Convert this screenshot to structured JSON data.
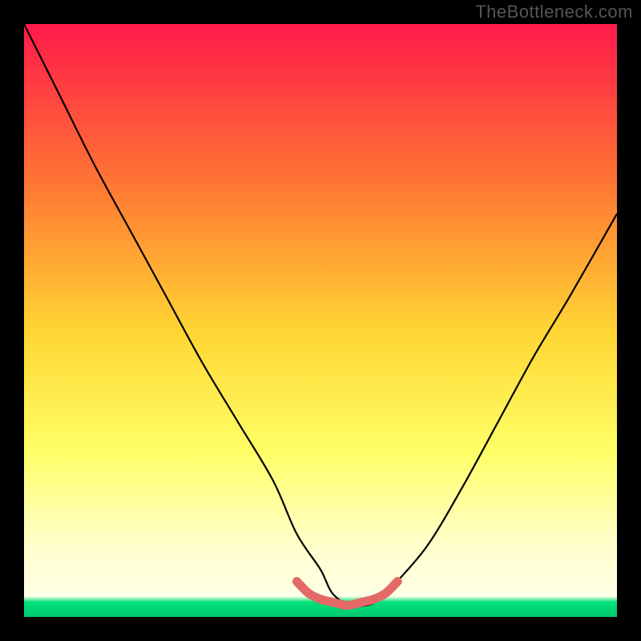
{
  "watermark": "TheBottleneck.com",
  "colors": {
    "background": "#000000",
    "watermark": "#555555",
    "curve": "#000000",
    "overlay": "#e36a67",
    "gradient_top": "#ff1a4a",
    "gradient_mid_upper": "#ff7a33",
    "gradient_mid": "#ffd633",
    "gradient_mid_lower": "#ffff66",
    "gradient_pale": "#ffffcc",
    "gradient_bottom": "#00e07a"
  },
  "chart_data": {
    "type": "line",
    "title": "",
    "xlabel": "",
    "ylabel": "",
    "xlim": [
      0,
      100
    ],
    "ylim": [
      0,
      100
    ],
    "series": [
      {
        "name": "main-curve",
        "x": [
          0,
          6,
          12,
          18,
          24,
          30,
          36,
          42,
          46,
          50,
          52,
          55,
          58,
          60,
          62,
          68,
          74,
          80,
          86,
          92,
          100
        ],
        "y": [
          100,
          88,
          76,
          65,
          54,
          43,
          33,
          23,
          14,
          8,
          4,
          2,
          2,
          3,
          5,
          12,
          22,
          33,
          44,
          54,
          68
        ]
      },
      {
        "name": "bottom-overlay",
        "x": [
          46,
          48,
          50,
          52,
          54,
          55,
          57,
          59,
          61,
          63
        ],
        "y": [
          6,
          4,
          3,
          2.5,
          2,
          2,
          2.5,
          3,
          4,
          6
        ]
      }
    ],
    "gradient_stops": [
      {
        "offset": 0.0,
        "color": "#ff1a4a"
      },
      {
        "offset": 0.28,
        "color": "#ff7a33"
      },
      {
        "offset": 0.52,
        "color": "#ffd633"
      },
      {
        "offset": 0.72,
        "color": "#ffff66"
      },
      {
        "offset": 0.88,
        "color": "#ffffcc"
      },
      {
        "offset": 0.965,
        "color": "#ffffe6"
      },
      {
        "offset": 0.975,
        "color": "#00e07a"
      },
      {
        "offset": 1.0,
        "color": "#00c86e"
      }
    ]
  }
}
